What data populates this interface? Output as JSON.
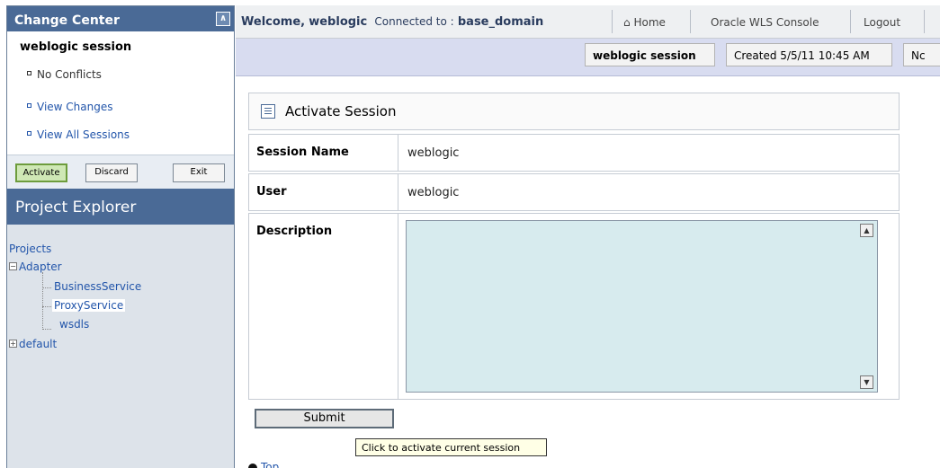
{
  "change_center": {
    "title": "Change Center",
    "session_name": "weblogic session",
    "items": [
      "No Conflicts",
      "View Changes",
      "View All Sessions"
    ],
    "buttons": {
      "activate": "Activate",
      "discard": "Discard",
      "exit": "Exit"
    }
  },
  "project_explorer": {
    "title": "Project Explorer",
    "root": "Projects",
    "tree": {
      "adapter": "Adapter",
      "children": [
        "BusinessService",
        "ProxyService",
        "wsdls"
      ],
      "default": "default"
    }
  },
  "topbar": {
    "welcome_prefix": "Welcome,",
    "user": "weblogic",
    "connected_label": "Connected to :",
    "domain": "base_domain",
    "home": "Home",
    "console": "Oracle WLS Console",
    "logout": "Logout"
  },
  "subbar": {
    "session": "weblogic session",
    "created": "Created 5/5/11 10:45 AM",
    "cut_text": "Nc"
  },
  "form": {
    "title": "Activate Session",
    "session_name_label": "Session Name",
    "session_name_value": "weblogic",
    "user_label": "User",
    "user_value": "weblogic",
    "description_label": "Description",
    "submit_label": "Submit",
    "tooltip": "Click to activate current session",
    "top_link": "Top"
  },
  "colors": {
    "header_blue": "#4a6a96",
    "textarea_bg": "#d7ebee",
    "link": "#2255aa"
  }
}
